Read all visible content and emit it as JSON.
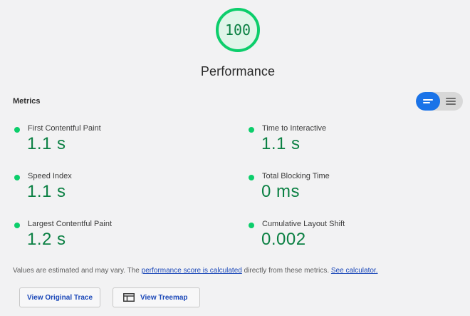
{
  "gauge": {
    "score": "100",
    "score_fraction": 1.0,
    "color": "#0cce6b"
  },
  "category": {
    "title": "Performance"
  },
  "metrics": {
    "header": "Metrics",
    "view_toggle": {
      "active": "view-list-icon",
      "inactive": "view-text-icon",
      "active_color": "#1a73e8"
    },
    "items": [
      {
        "label": "First Contentful Paint",
        "value": "1.1 s",
        "status": "pass"
      },
      {
        "label": "Time to Interactive",
        "value": "1.1 s",
        "status": "pass"
      },
      {
        "label": "Speed Index",
        "value": "1.1 s",
        "status": "pass"
      },
      {
        "label": "Total Blocking Time",
        "value": "0 ms",
        "status": "pass"
      },
      {
        "label": "Largest Contentful Paint",
        "value": "1.2 s",
        "status": "pass"
      },
      {
        "label": "Cumulative Layout Shift",
        "value": "0.002",
        "status": "pass"
      }
    ],
    "pass_color": "#0cce6b",
    "value_color": "#0b8043"
  },
  "note": {
    "prefix": "Values are estimated and may vary. The ",
    "link1": "performance score is calculated",
    "middle": " directly from these metrics. ",
    "link2": "See calculator."
  },
  "buttons": {
    "view_trace": "View Original Trace",
    "view_treemap": "View Treemap",
    "treemap_icon": "treemap-icon"
  }
}
